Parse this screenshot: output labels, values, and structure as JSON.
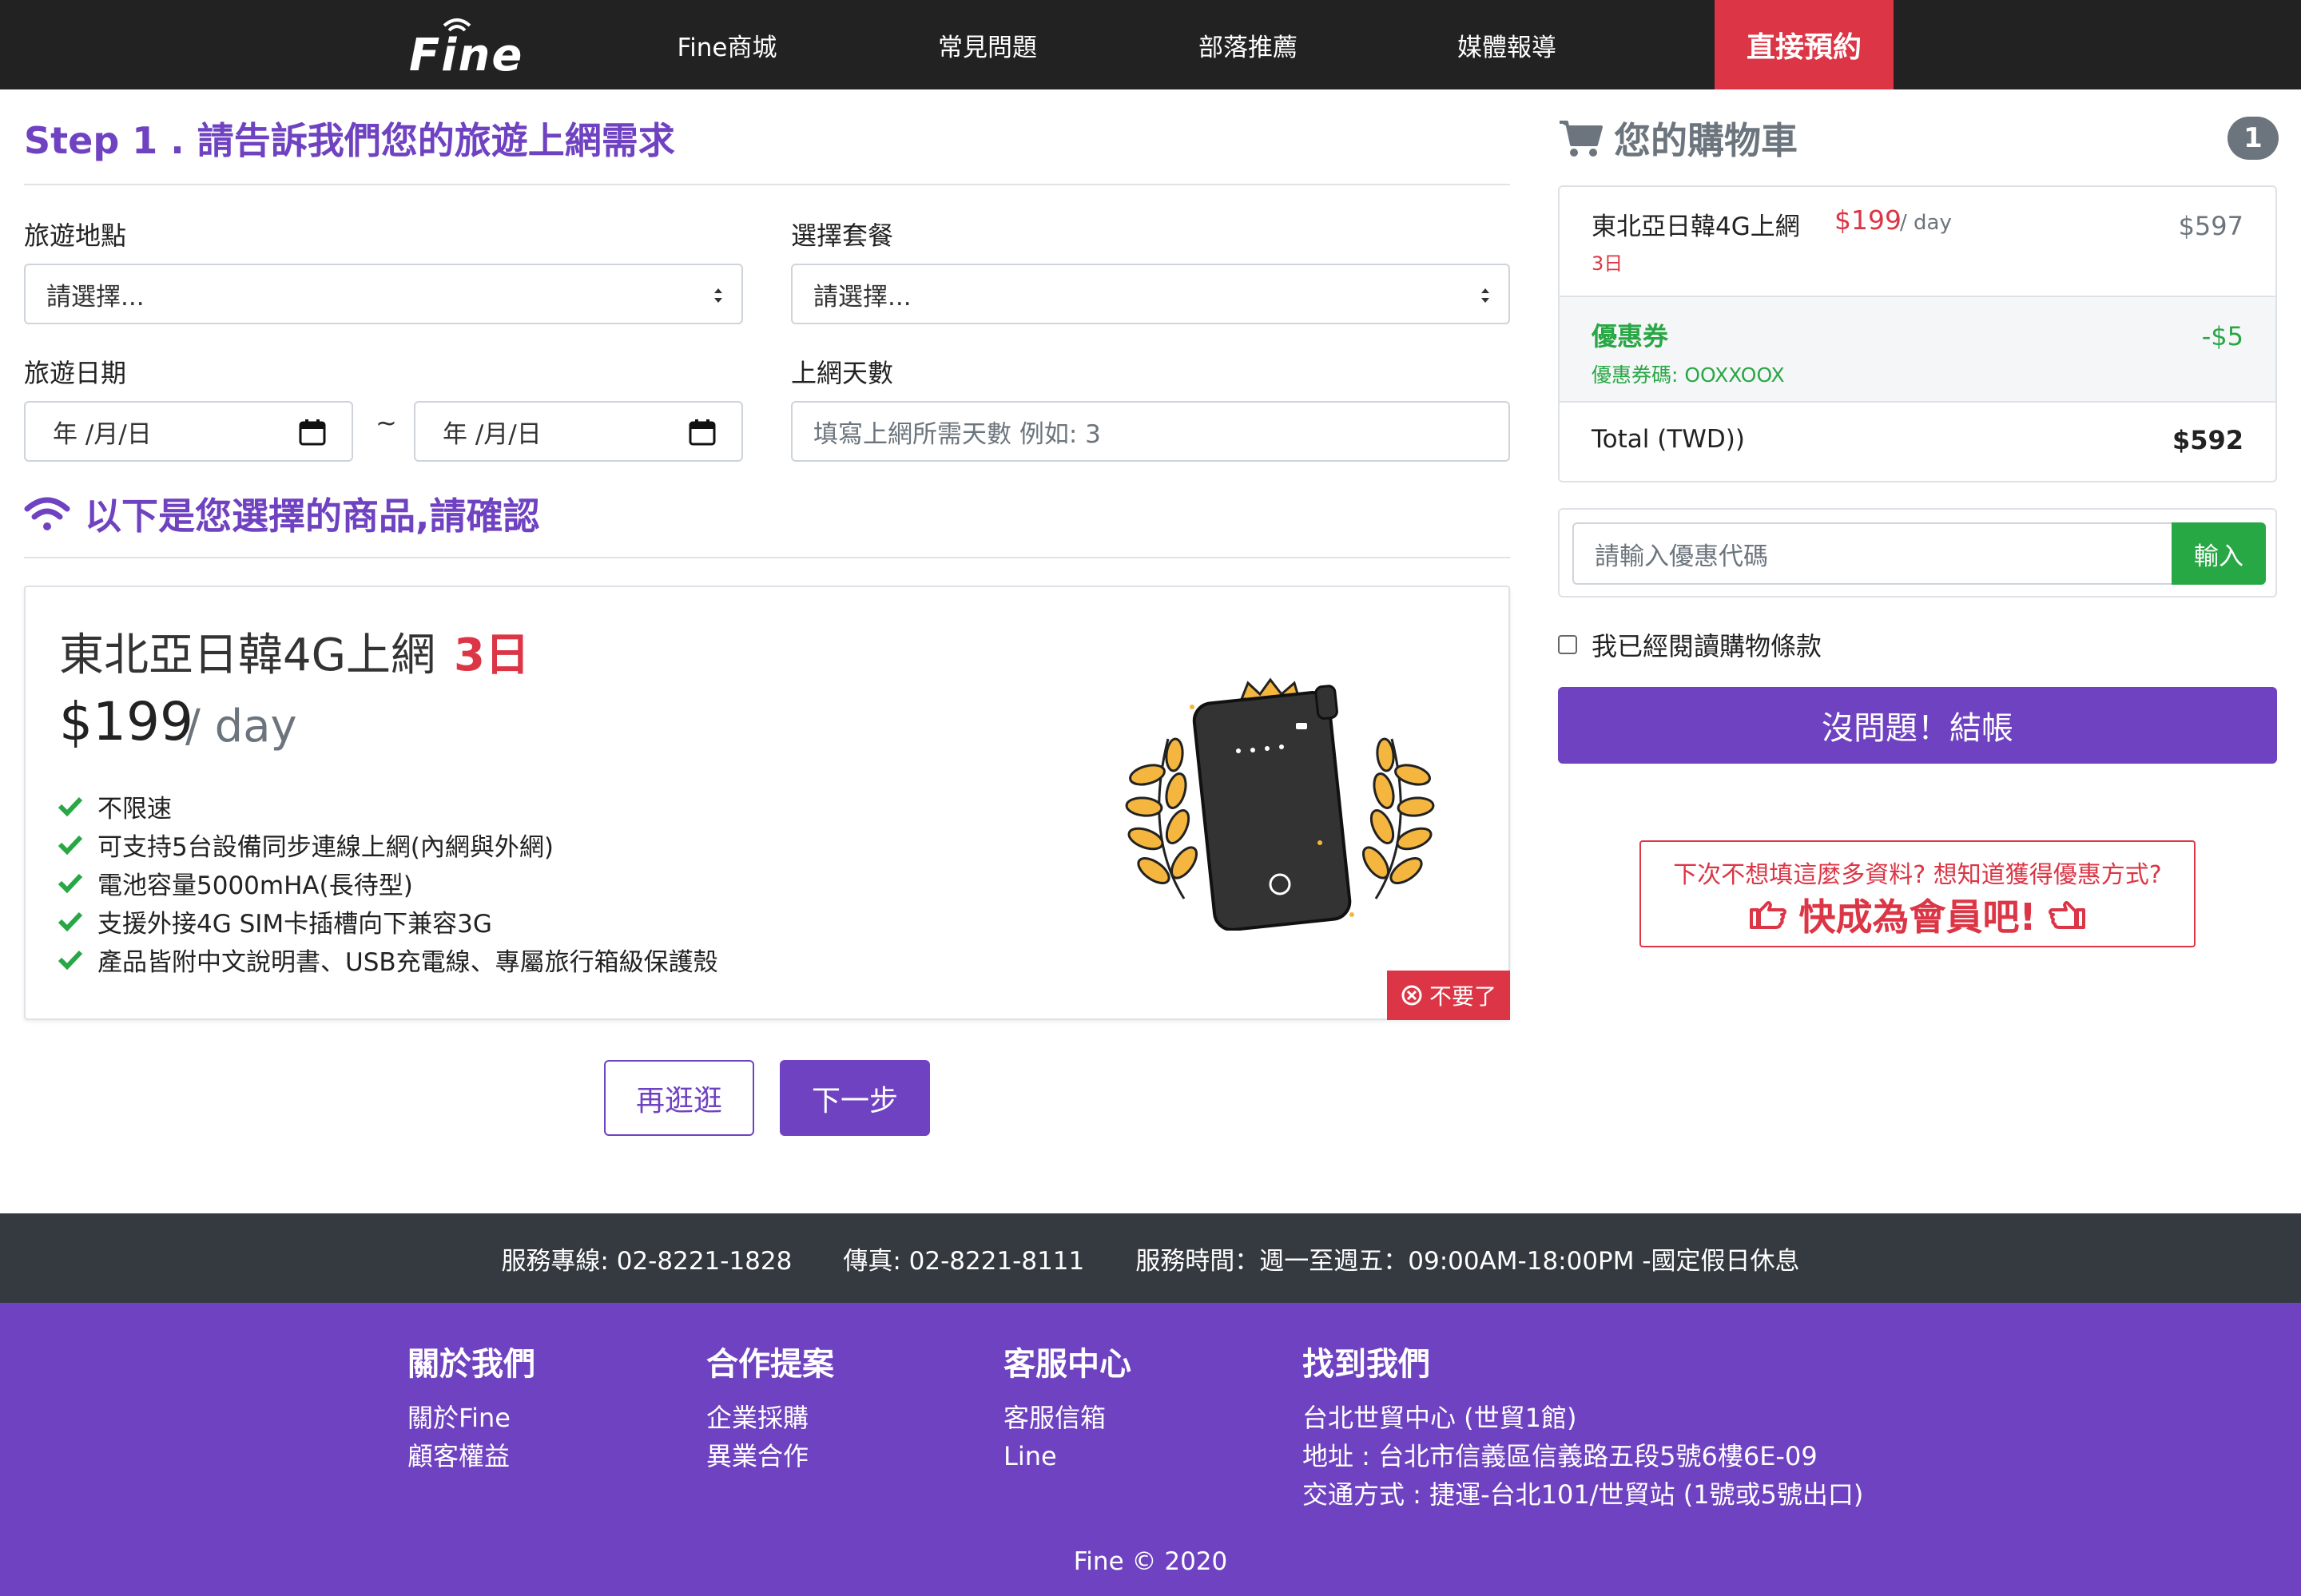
{
  "nav": {
    "logo": "Fine",
    "items": [
      "Fine商城",
      "常見問題",
      "部落推薦",
      "媒體報導"
    ],
    "cta": "直接預約",
    "cta_color": "#dc3545"
  },
  "step1": {
    "title": "Step 1 . 請告訴我們您的旅遊上網需求",
    "destination_label": "旅遊地點",
    "destination_value": "請選擇...",
    "plan_label": "選擇套餐",
    "plan_value": "請選擇...",
    "date_label": "旅遊日期",
    "date_start": "年 /月/日",
    "date_sep": "~",
    "date_end": "年 /月/日",
    "days_label": "上網天數",
    "days_placeholder": "填寫上網所需天數 例如: 3"
  },
  "confirm": {
    "title": "以下是您選擇的商品,請確認"
  },
  "product": {
    "name": "東北亞日韓4G上網",
    "days": "3日",
    "price": "$199",
    "unit": "/ day",
    "features": [
      "不限速",
      "可支持5台設備同步連線上網(內網與外網)",
      "電池容量5000mHA(長待型)",
      "支援外接4G SIM卡插槽向下兼容3G",
      "產品皆附中文說明書、USB充電線、專屬旅行箱級保護殼"
    ],
    "remove_label": "不要了"
  },
  "actions": {
    "browse_label": "再逛逛",
    "next_label": "下一步"
  },
  "cart": {
    "title": "您的購物車",
    "count": "1",
    "item_name": "東北亞日韓4G上網",
    "item_price": "$199",
    "item_unit": "/ day",
    "item_days": "3日",
    "item_total": "$597",
    "coupon_name": "優惠券",
    "coupon_code": "優惠券碼: OOXXOOX",
    "coupon_amount": "-$5",
    "total_label": "Total (TWD))",
    "total_amount": "$592",
    "promo_placeholder": "請輸入優惠代碼",
    "promo_button": "輸入",
    "agree_label": "我已經閱讀購物條款",
    "checkout_label": "沒問題！結帳"
  },
  "member": {
    "hint": "下次不想填這麼多資料? 想知道獲得優惠方式?",
    "cta": "快成為會員吧!"
  },
  "footer": {
    "hotline": "服務專線: 02-8221-1828",
    "fax": "傳真: 02-8221-8111",
    "hours": "服務時間：週一至週五：09:00AM-18:00PM -國定假日休息",
    "columns": [
      {
        "title": "關於我們",
        "links": [
          "關於Fine",
          "顧客權益"
        ]
      },
      {
        "title": "合作提案",
        "links": [
          "企業採購",
          "異業合作"
        ]
      },
      {
        "title": "客服中心",
        "links": [
          "客服信箱",
          "Line"
        ]
      },
      {
        "title": "找到我們",
        "links": [
          "台北世貿中心 (世貿1館)",
          "地址 : 台北市信義區信義路五段5號6樓6E-09",
          "交通方式 : 捷運-台北101/世貿站 (1號或5號出口)"
        ]
      }
    ],
    "copyright": "Fine © 2020"
  },
  "colors": {
    "brand_purple": "#6f42c1",
    "danger_red": "#dc3545",
    "success_green": "#28a745",
    "nav_dark": "#222222"
  }
}
